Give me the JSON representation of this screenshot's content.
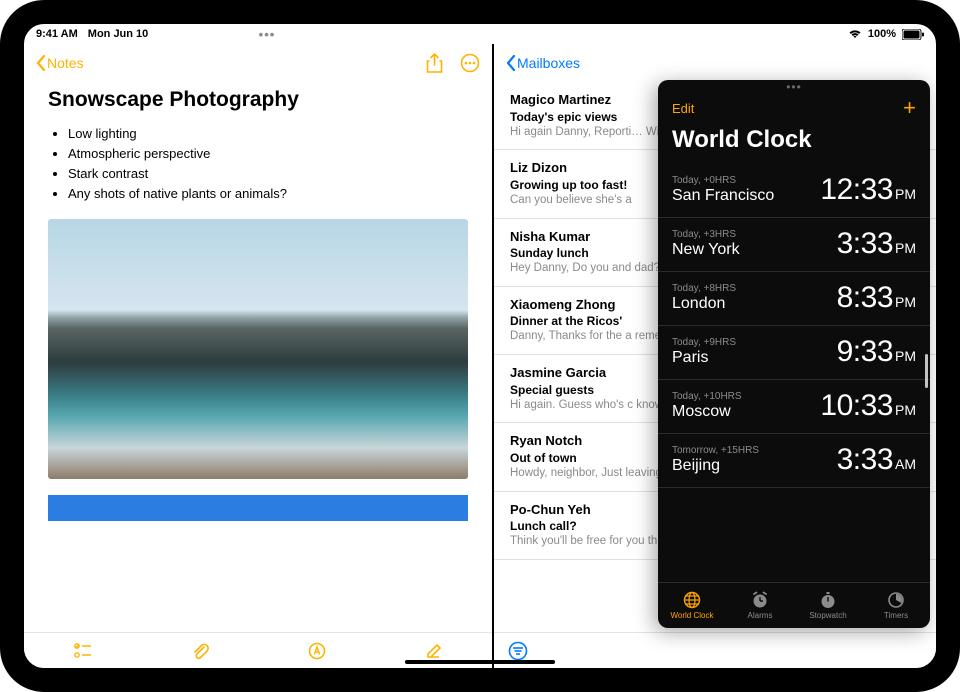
{
  "statusbar": {
    "time": "9:41 AM",
    "date": "Mon Jun 10",
    "battery": "100%"
  },
  "notes": {
    "back": "Notes",
    "title": "Snowscape Photography",
    "bullets": [
      "Low lighting",
      "Atmospheric perspective",
      "Stark contrast",
      "Any shots of native plants or animals?"
    ]
  },
  "mail": {
    "back": "Mailboxes",
    "items": [
      {
        "sender": "Magico Martinez",
        "subject": "Today's epic views",
        "preview": "Hi again Danny, Reporti… Wide open skies, a ger"
      },
      {
        "sender": "Liz Dizon",
        "subject": "Growing up too fast!",
        "preview": "Can you believe she's a"
      },
      {
        "sender": "Nisha Kumar",
        "subject": "Sunday lunch",
        "preview": "Hey Danny, Do you and dad? If you two join, th"
      },
      {
        "sender": "Xiaomeng Zhong",
        "subject": "Dinner at the Ricos'",
        "preview": "Danny, Thanks for the a remembered to take or"
      },
      {
        "sender": "Jasmine Garcia",
        "subject": "Special guests",
        "preview": "Hi again. Guess who's c know how to make me"
      },
      {
        "sender": "Ryan Notch",
        "subject": "Out of town",
        "preview": "Howdy, neighbor, Just leaving Tuesday and wi"
      },
      {
        "sender": "Po-Chun Yeh",
        "subject": "Lunch call?",
        "preview": "Think you'll be free for you think might work a"
      }
    ]
  },
  "clock": {
    "edit": "Edit",
    "title": "World Clock",
    "rows": [
      {
        "offset": "Today, +0HRS",
        "city": "San Francisco",
        "time": "12:33",
        "ampm": "PM"
      },
      {
        "offset": "Today, +3HRS",
        "city": "New York",
        "time": "3:33",
        "ampm": "PM"
      },
      {
        "offset": "Today, +8HRS",
        "city": "London",
        "time": "8:33",
        "ampm": "PM"
      },
      {
        "offset": "Today, +9HRS",
        "city": "Paris",
        "time": "9:33",
        "ampm": "PM"
      },
      {
        "offset": "Today, +10HRS",
        "city": "Moscow",
        "time": "10:33",
        "ampm": "PM"
      },
      {
        "offset": "Tomorrow, +15HRS",
        "city": "Beijing",
        "time": "3:33",
        "ampm": "AM"
      }
    ],
    "tabs": [
      {
        "label": "World Clock"
      },
      {
        "label": "Alarms"
      },
      {
        "label": "Stopwatch"
      },
      {
        "label": "Timers"
      }
    ]
  }
}
